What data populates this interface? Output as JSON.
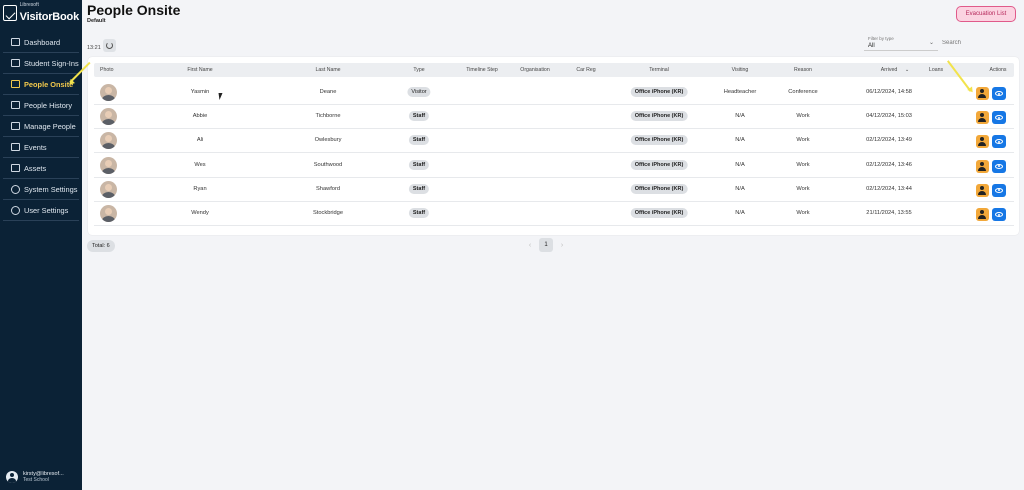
{
  "brand": {
    "small": "Libresoft",
    "name": "VisitorBook"
  },
  "nav": [
    {
      "label": "Dashboard",
      "icon": "dashboard-icon",
      "active": false
    },
    {
      "label": "Student Sign-Ins",
      "icon": "student-icon",
      "active": false
    },
    {
      "label": "People Onsite",
      "icon": "people-icon",
      "active": true
    },
    {
      "label": "People History",
      "icon": "history-icon",
      "active": false
    },
    {
      "label": "Manage People",
      "icon": "id-card-icon",
      "active": false
    },
    {
      "label": "Events",
      "icon": "events-icon",
      "active": false
    },
    {
      "label": "Assets",
      "icon": "assets-icon",
      "active": false
    },
    {
      "label": "System Settings",
      "icon": "gear-icon",
      "active": false
    },
    {
      "label": "User Settings",
      "icon": "user-icon",
      "active": false
    }
  ],
  "user": {
    "email": "kirsty@libresof...",
    "school": "Test School"
  },
  "header": {
    "title": "People Onsite",
    "subtitle": "Default",
    "evacuation_label": "Evacuation List",
    "time": "13:21"
  },
  "filter": {
    "label": "Filter by type",
    "value": "All"
  },
  "search": {
    "placeholder": "Search"
  },
  "table": {
    "columns": [
      "Photo",
      "First Name",
      "Last Name",
      "Type",
      "Timeline Step",
      "Organisation",
      "Car Reg",
      "Terminal",
      "Visiting",
      "Reason",
      "Arrived",
      "Loans",
      "Actions"
    ],
    "rows": [
      {
        "first": "Yasmin",
        "last": "Deane",
        "type": "Visitor",
        "terminal": "Office iPhone (KR)",
        "visiting": "Headteacher",
        "reason": "Conference",
        "arrived": "06/12/2024, 14:58"
      },
      {
        "first": "Abbie",
        "last": "Tichborne",
        "type": "Staff",
        "terminal": "Office iPhone (KR)",
        "visiting": "N/A",
        "reason": "Work",
        "arrived": "04/12/2024, 15:03"
      },
      {
        "first": "Ali",
        "last": "Owlesbury",
        "type": "Staff",
        "terminal": "Office iPhone (KR)",
        "visiting": "N/A",
        "reason": "Work",
        "arrived": "02/12/2024, 13:49"
      },
      {
        "first": "Wes",
        "last": "Southwood",
        "type": "Staff",
        "terminal": "Office iPhone (KR)",
        "visiting": "N/A",
        "reason": "Work",
        "arrived": "02/12/2024, 13:46"
      },
      {
        "first": "Ryan",
        "last": "Shawford",
        "type": "Staff",
        "terminal": "Office iPhone (KR)",
        "visiting": "N/A",
        "reason": "Work",
        "arrived": "02/12/2024, 13:44"
      },
      {
        "first": "Wendy",
        "last": "Stockbridge",
        "type": "Staff",
        "terminal": "Office iPhone (KR)",
        "visiting": "N/A",
        "reason": "Work",
        "arrived": "21/11/2024, 13:55"
      }
    ]
  },
  "footer": {
    "total": "Total: 6",
    "page": "1"
  },
  "colors": {
    "sidebar": "#0b2236",
    "active": "#f2c94c",
    "evac_action": "#f2a83a",
    "view_action": "#1677e5",
    "evac_button": "#fbd3e1"
  }
}
